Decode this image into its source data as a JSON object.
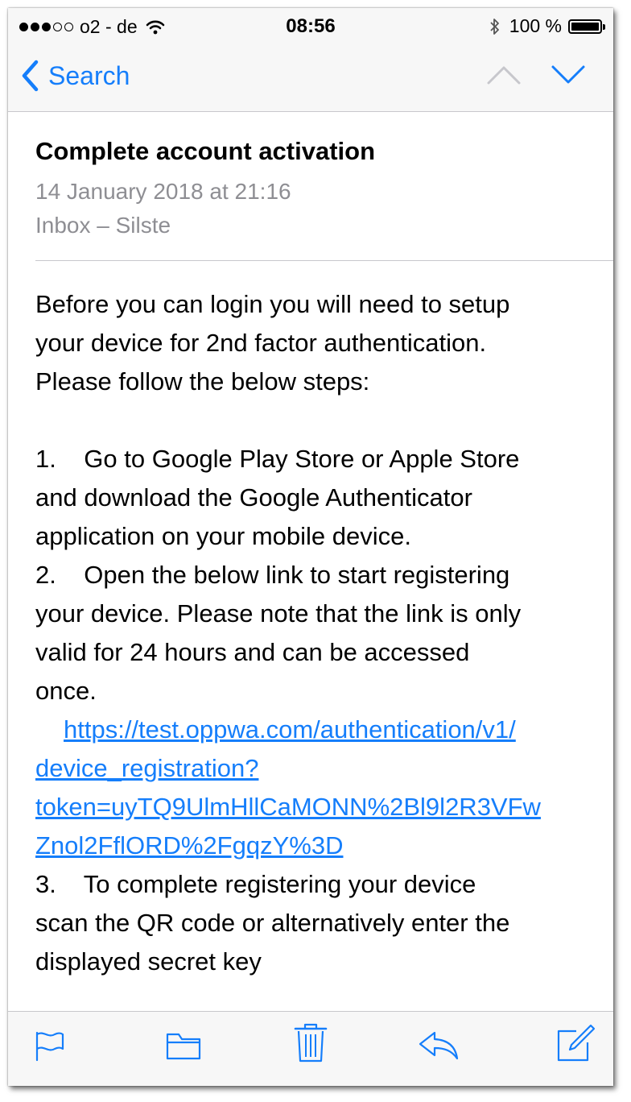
{
  "status_bar": {
    "carrier": "o2 - de",
    "time": "08:56",
    "battery": "100 %",
    "signal_bars_filled": 3,
    "signal_bars_total": 5
  },
  "nav": {
    "back_label": "Search",
    "icons": [
      "chevron-left-icon",
      "chevron-up-icon",
      "chevron-down-icon"
    ]
  },
  "email": {
    "subject": "Complete account activation",
    "date": "14 January 2018 at 21:16",
    "mailbox": "Inbox – Silste",
    "body": {
      "line1": "Before you can login you will need to setup",
      "line2": "your device for 2nd factor authentication.",
      "line3": "Please follow the below steps:",
      "step1_line1": "1.    Go to Google Play Store or Apple Store",
      "step1_line2": "and download the Google Authenticator",
      "step1_line3": "application on your mobile device.",
      "step2_line1": "2.    Open the below link to start registering",
      "step2_line2": "your device. Please note that the link is only",
      "step2_line3": "valid for 24 hours and can be accessed",
      "step2_line4": "once.",
      "link_line1": "https://test.oppwa.com/authentication/v1/",
      "link_line2": "device_registration?",
      "link_line3": "token=uyTQ9UlmHllCaMONN%2Bl9l2R3VFw",
      "link_line4": "Znol2FflORD%2FgqzY%3D",
      "step3_line1": "3.    To complete registering your device",
      "step3_line2": "scan the QR code or alternatively enter the",
      "step3_line3": "displayed secret key"
    }
  },
  "toolbar": {
    "icons": [
      "flag-icon",
      "folder-icon",
      "trash-icon",
      "reply-icon",
      "compose-icon"
    ]
  },
  "colors": {
    "accent": "#157efb",
    "secondary_text": "#8e8e93",
    "bar_background": "#f7f7f7",
    "separator": "#c8c7cc"
  }
}
